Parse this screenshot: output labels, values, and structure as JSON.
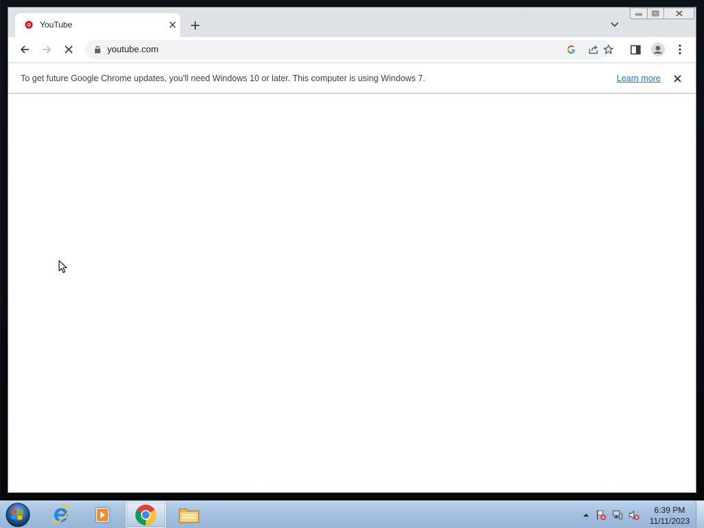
{
  "browser": {
    "tab": {
      "title": "YouTube"
    },
    "address_bar": {
      "url": "youtube.com"
    },
    "infobar": {
      "message": "To get future Google Chrome updates, you'll need Windows 10 or later. This computer is using Windows 7.",
      "link_label": "Learn more"
    },
    "icons": {
      "back": "arrow-left-icon",
      "forward": "arrow-right-icon",
      "stop": "stop-loading-icon",
      "google_lens": "google-g-icon",
      "share": "share-icon",
      "bookmark": "star-icon",
      "side_panel": "side-panel-icon",
      "profile": "profile-avatar-icon",
      "menu": "kebab-menu-icon"
    }
  },
  "taskbar": {
    "apps": [
      "start-orb",
      "internet-explorer",
      "windows-media-player",
      "google-chrome",
      "file-explorer"
    ],
    "active_app": "google-chrome",
    "clock": {
      "time": "6:39 PM",
      "date": "11/11/2023"
    }
  },
  "colors": {
    "tabstrip": "#dee1e6",
    "omnibox": "#f1f3f4",
    "link": "#1a73e8",
    "youtube_red": "#ff0000"
  }
}
